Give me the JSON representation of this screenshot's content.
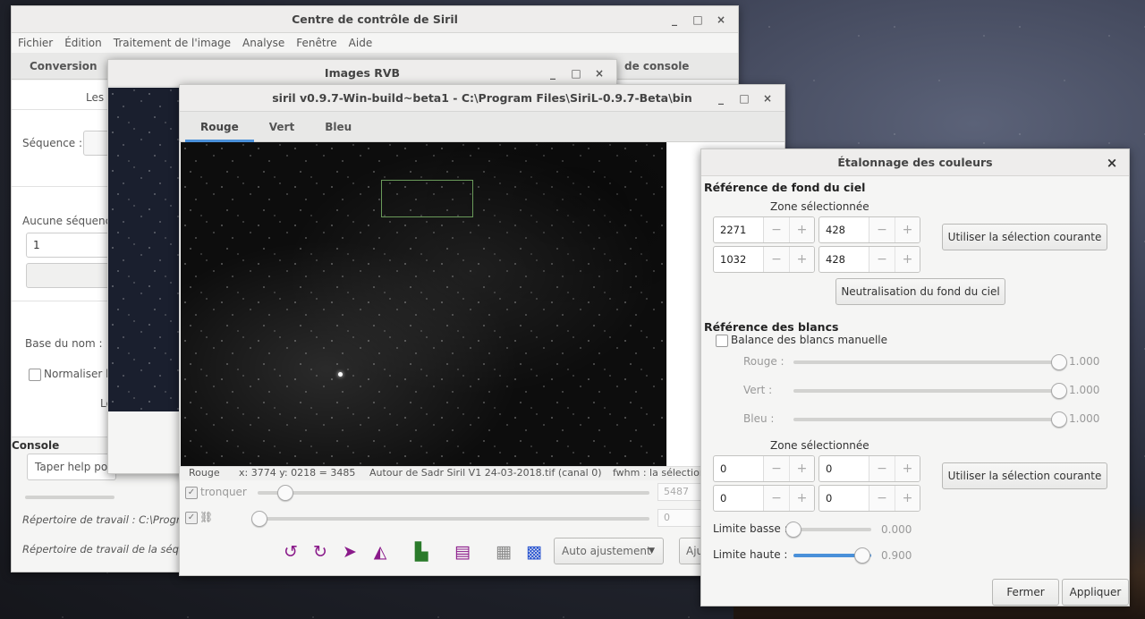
{
  "control": {
    "title": "Centre de contrôle de Siril",
    "menu": [
      "Fichier",
      "Édition",
      "Traitement de l'image",
      "Analyse",
      "Fenêtre",
      "Aide"
    ],
    "tab_conversion": "Conversion",
    "tab_console_partial": "de console",
    "les_partial": "Les i",
    "sequence_label": "Séquence :",
    "no_sequence": "Aucune séquence",
    "spin_value": "1",
    "base_name_label": "Base du nom :",
    "normalize_label": "Normaliser le",
    "le_partial": "Le",
    "console_label": "Console",
    "console_input": "Taper help pou",
    "workdir": "Répertoire de travail : C:\\Prograi",
    "seq_workdir": "Répertoire de travail de la séque"
  },
  "rgb": {
    "title": "Images RVB"
  },
  "main": {
    "title": "siril v0.9.7-Win-build~beta1 - C:\\Program Files\\SiriL-0.9.7-Beta\\bin",
    "tabs": [
      "Rouge",
      "Vert",
      "Bleu"
    ],
    "status": {
      "channel": "Rouge",
      "coords": "x: 3774 y: 0218 = 3485",
      "file": "Autour de Sadr Siril V1 24-03-2018.tif (canal 0)",
      "fwhm": "fwhm : la sélection"
    },
    "tronquer_label": "tronquer",
    "tronquer_value": "5487",
    "lower_value": "0",
    "auto_adjust": "Auto ajustement",
    "aju_partial": "Aju",
    "tronquer_level": 0.07,
    "lower_level": 0.0
  },
  "calib": {
    "title": "Étalonnage des couleurs",
    "bg_section": "Référence de fond du ciel",
    "zone_label": "Zone sélectionnée",
    "bg_x": "2271",
    "bg_w": "428",
    "bg_y": "1032",
    "bg_h": "428",
    "use_selection": "Utiliser la sélection courante",
    "neutralize": "Neutralisation du fond du ciel",
    "white_section": "Référence des blancs",
    "manual_wb": "Balance des blancs manuelle",
    "rouge_label": "Rouge :",
    "rouge_value": "1.000",
    "vert_label": "Vert :",
    "vert_value": "1.000",
    "bleu_label": "Bleu :",
    "bleu_value": "1.000",
    "zone2_label": "Zone sélectionnée",
    "w_x": "0",
    "w_w": "0",
    "w_y": "0",
    "w_h": "0",
    "use_selection2": "Utiliser la sélection courante",
    "low_label": "Limite basse :",
    "low_value": "0.000",
    "high_label": "Limite haute :",
    "high_value": "0.900",
    "close": "Fermer",
    "apply": "Appliquer"
  },
  "glyphs": {
    "minus": "−",
    "plus": "+",
    "close": "×",
    "minimize": "_",
    "maximize": "□"
  }
}
